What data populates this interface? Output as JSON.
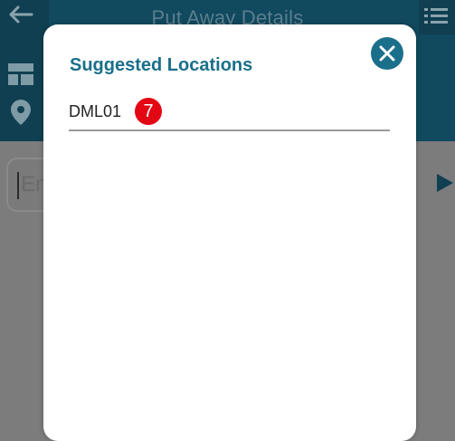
{
  "app_bar": {
    "title": "Put Away Details",
    "back_icon": "back-arrow-icon",
    "menu_icon": "list-menu-icon"
  },
  "sidebar": {
    "icons": [
      "layout-icon",
      "location-pin-icon"
    ]
  },
  "background_input": {
    "placeholder_fragment": "En"
  },
  "modal": {
    "title": "Suggested Locations",
    "close_icon": "close-icon",
    "locations": [
      {
        "code": "DML01",
        "count": "7"
      }
    ]
  },
  "colors": {
    "primary_dark": "#11495f",
    "accent": "#1a6f8a",
    "badge_red": "#e30613"
  }
}
